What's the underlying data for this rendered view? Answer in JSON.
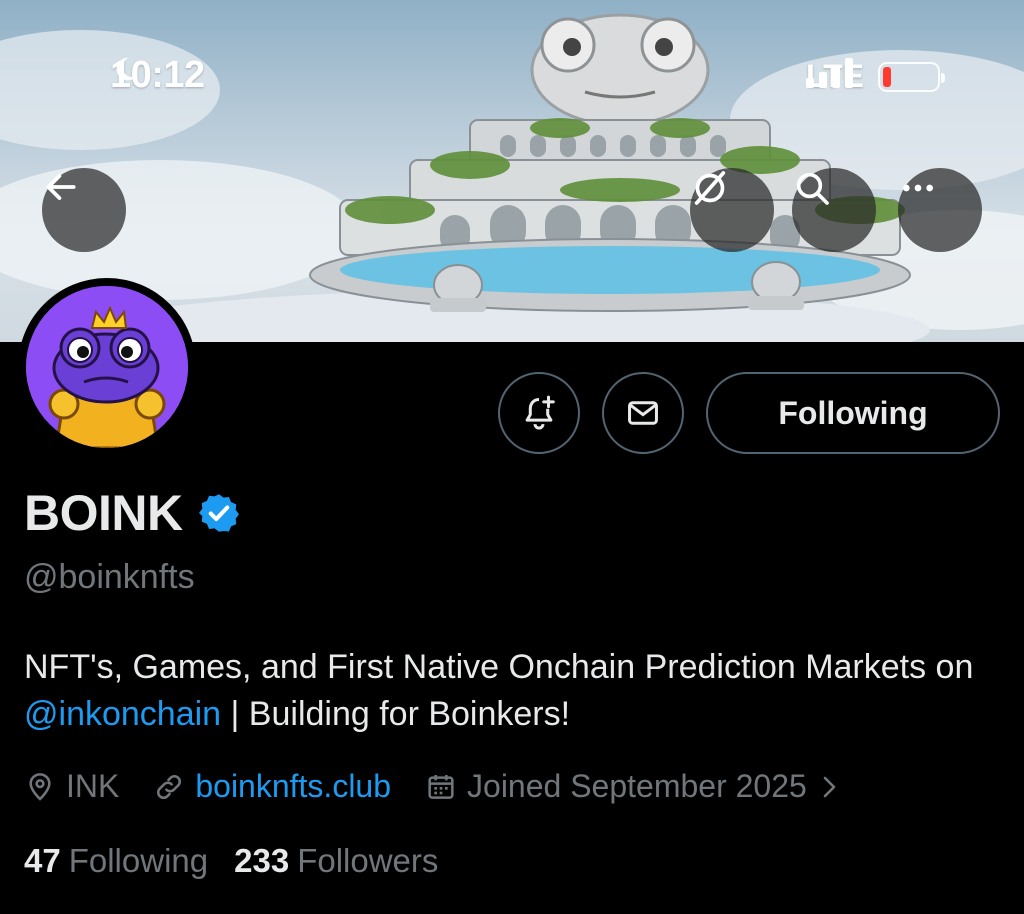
{
  "status_bar": {
    "time": "10:12",
    "network": "LTE",
    "battery_color": "#ff3b30"
  },
  "banner": {
    "back_icon": "arrow-left-icon",
    "grok_icon": "grok-icon",
    "search_icon": "search-icon",
    "more_icon": "more-horizontal-icon"
  },
  "profile": {
    "name": "BOINK",
    "verified_icon": "verified-badge-icon",
    "handle": "@boinknfts",
    "bio_pre": "NFT's, Games, and First Native Onchain Prediction Markets on ",
    "bio_mention": "@inkonchain",
    "bio_post": " | Building for Boinkers!",
    "location": "INK",
    "website": "boinknfts.club",
    "joined": "Joined September 2025",
    "following_count": "47",
    "following_label": "Following",
    "followers_count": "233",
    "followers_label": "Followers"
  },
  "actions": {
    "notify_icon": "bell-plus-icon",
    "message_icon": "envelope-icon",
    "following_button": "Following"
  },
  "colors": {
    "accent": "#1d9bf0",
    "secondary_text": "#71767b",
    "avatar_bg": "#8d4df5"
  }
}
